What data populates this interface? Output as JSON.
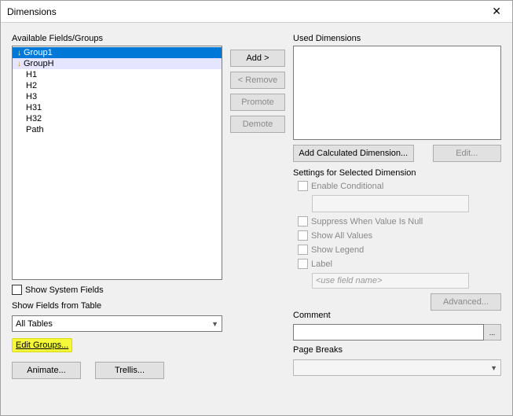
{
  "window": {
    "title": "Dimensions",
    "close": "✕"
  },
  "left": {
    "available_label": "Available Fields/Groups",
    "items": [
      {
        "label": "Group1",
        "group": true,
        "state": "selected"
      },
      {
        "label": "GroupH",
        "group": true,
        "state": "hover"
      },
      {
        "label": "H1"
      },
      {
        "label": "H2"
      },
      {
        "label": "H3"
      },
      {
        "label": "H31"
      },
      {
        "label": "H32"
      },
      {
        "label": "Path"
      }
    ],
    "show_system": "Show System Fields",
    "show_from_label": "Show Fields from Table",
    "table_selected": "All Tables",
    "edit_groups": "Edit Groups...",
    "animate": "Animate...",
    "trellis": "Trellis..."
  },
  "mid": {
    "add": "Add >",
    "remove": "< Remove",
    "promote": "Promote",
    "demote": "Demote"
  },
  "right": {
    "used_label": "Used Dimensions",
    "add_calc": "Add Calculated Dimension...",
    "edit": "Edit...",
    "settings_label": "Settings for Selected Dimension",
    "enable_cond": "Enable Conditional",
    "suppress": "Suppress When Value Is Null",
    "show_all": "Show All Values",
    "show_legend": "Show Legend",
    "label_chk": "Label",
    "label_placeholder": "<use field name>",
    "advanced": "Advanced...",
    "comment_label": "Comment",
    "comment_btn": "...",
    "pagebreaks_label": "Page Breaks"
  }
}
